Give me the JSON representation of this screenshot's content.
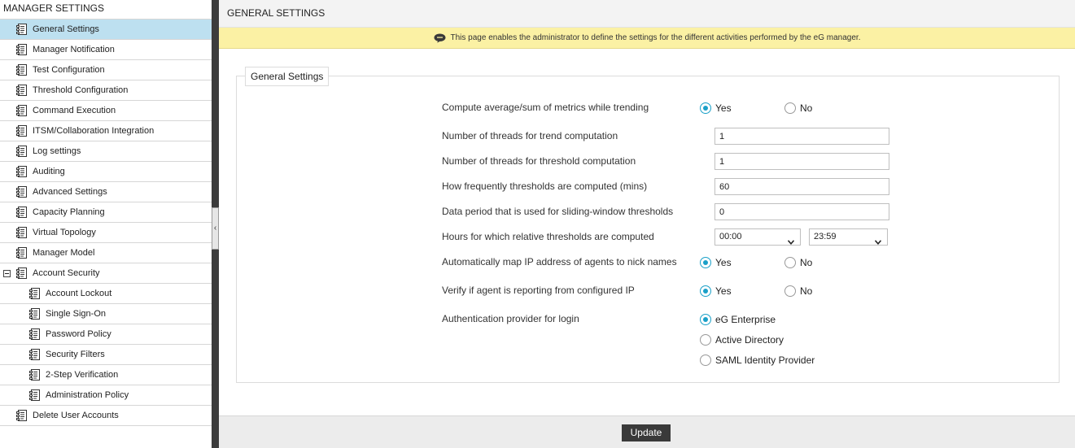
{
  "sidebar": {
    "title": "MANAGER SETTINGS",
    "items": [
      {
        "label": "General Settings"
      },
      {
        "label": "Manager Notification"
      },
      {
        "label": "Test Configuration"
      },
      {
        "label": "Threshold Configuration"
      },
      {
        "label": "Command Execution"
      },
      {
        "label": "ITSM/Collaboration Integration"
      },
      {
        "label": "Log settings"
      },
      {
        "label": "Auditing"
      },
      {
        "label": "Advanced Settings"
      },
      {
        "label": "Capacity Planning"
      },
      {
        "label": "Virtual Topology"
      },
      {
        "label": "Manager Model"
      },
      {
        "label": "Account Security"
      },
      {
        "label": "Account Lockout"
      },
      {
        "label": "Single Sign-On"
      },
      {
        "label": "Password Policy"
      },
      {
        "label": "Security Filters"
      },
      {
        "label": "2-Step Verification"
      },
      {
        "label": "Administration Policy"
      },
      {
        "label": "Delete User Accounts"
      }
    ],
    "active_item": "General Settings",
    "splitter_glyph": "‹"
  },
  "header": {
    "title": "GENERAL SETTINGS"
  },
  "notice": {
    "text": "This page enables the administrator to define the settings for the different activities performed by the eG manager."
  },
  "form": {
    "legend": "General Settings",
    "trending": {
      "label": "Compute average/sum of metrics while trending",
      "yes": "Yes",
      "no": "No",
      "selected": "Yes"
    },
    "trend_threads": {
      "label": "Number of threads for trend computation",
      "value": "1"
    },
    "threshold_threads": {
      "label": "Number of threads for threshold computation",
      "value": "1"
    },
    "threshold_freq": {
      "label": "How frequently thresholds are computed (mins)",
      "value": "60"
    },
    "sliding_window": {
      "label": "Data period that is used for sliding-window thresholds",
      "value": "0"
    },
    "relative_hours": {
      "label": "Hours for which relative thresholds are computed",
      "from": "00:00",
      "to": "23:59"
    },
    "map_ip": {
      "label": "Automatically map IP address of agents to nick names",
      "yes": "Yes",
      "no": "No",
      "selected": "Yes"
    },
    "verify_ip": {
      "label": "Verify if agent is reporting from configured IP",
      "yes": "Yes",
      "no": "No",
      "selected": "Yes"
    },
    "auth": {
      "label": "Authentication provider for login",
      "options": [
        "eG Enterprise",
        "Active Directory",
        "SAML Identity Provider"
      ],
      "selected": "eG Enterprise"
    }
  },
  "footer": {
    "update_label": "Update"
  },
  "colors": {
    "accent": "#1aa0c8",
    "active_nav": "#bde0f0",
    "notice_bg": "#fbf1a4",
    "splitter": "#3c3c3c"
  },
  "icons": {
    "nav": "document-icon",
    "notice": "chat-bubble-icon",
    "collapse": "minus-box-icon",
    "dropdown": "chevron-down-icon"
  }
}
